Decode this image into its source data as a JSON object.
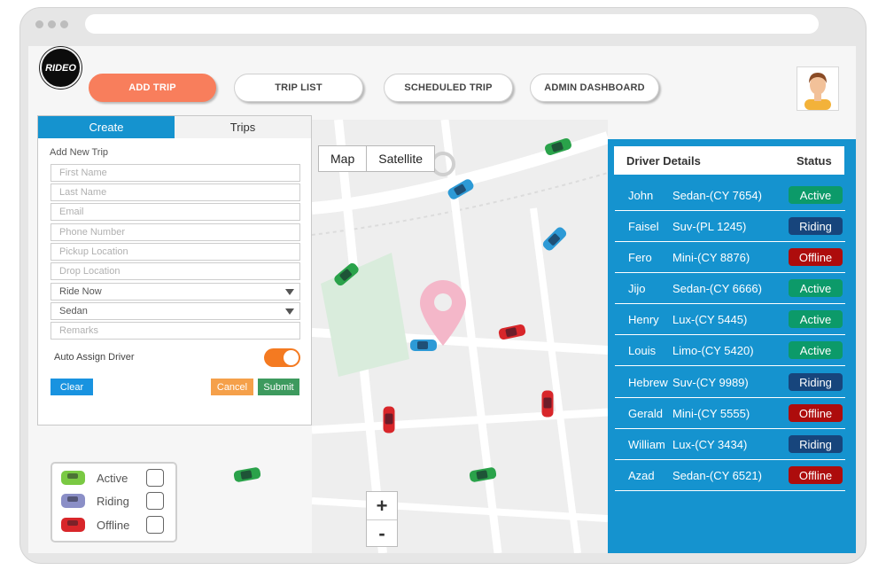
{
  "app": {
    "logo_text": "RIDEO"
  },
  "nav": {
    "add_trip": "ADD TRIP",
    "trip_list": "TRIP LIST",
    "scheduled_trip": "SCHEDULED TRIP",
    "admin_dashboard": "ADMIN DASHBOARD"
  },
  "form": {
    "tabs": {
      "create": "Create",
      "trips": "Trips"
    },
    "title": "Add New Trip",
    "fields": {
      "first_name": "First Name",
      "last_name": "Last Name",
      "email": "Email",
      "phone": "Phone Number",
      "pickup": "Pickup Location",
      "drop": "Drop Location",
      "ride_type": "Ride Now",
      "vehicle": "Sedan",
      "remarks": "Remarks"
    },
    "auto_assign_label": "Auto Assign Driver",
    "auto_assign_on": true,
    "clear": "Clear",
    "cancel": "Cancel",
    "submit": "Submit"
  },
  "map": {
    "type_map": "Map",
    "type_satellite": "Satellite",
    "zoom_in": "+",
    "zoom_out": "-"
  },
  "legend": {
    "active": "Active",
    "riding": "Riding",
    "offline": "Offline"
  },
  "drivers": {
    "header_details": "Driver Details",
    "header_status": "Status",
    "rows": [
      {
        "name": "John",
        "vehicle": "Sedan-(CY 7654)",
        "status": "Active"
      },
      {
        "name": "Faisel",
        "vehicle": "Suv-(PL 1245)",
        "status": "Riding"
      },
      {
        "name": "Fero",
        "vehicle": "Mini-(CY 8876)",
        "status": "Offline"
      },
      {
        "name": "Jijo",
        "vehicle": "Sedan-(CY 6666)",
        "status": "Active"
      },
      {
        "name": "Henry",
        "vehicle": "Lux-(CY 5445)",
        "status": "Active"
      },
      {
        "name": "Louis",
        "vehicle": "Limo-(CY 5420)",
        "status": "Active"
      },
      {
        "name": "Hebrew",
        "vehicle": "Suv-(CY 9989)",
        "status": "Riding"
      },
      {
        "name": "Gerald",
        "vehicle": "Mini-(CY 5555)",
        "status": "Offline"
      },
      {
        "name": "William",
        "vehicle": "Lux-(CY 3434)",
        "status": "Riding"
      },
      {
        "name": "Azad",
        "vehicle": "Sedan-(CY 6521)",
        "status": "Offline"
      }
    ]
  },
  "colors": {
    "accent": "#1593cf",
    "primary_button": "#f87e5c",
    "active": "#0c9a69",
    "riding": "#17457c",
    "offline": "#ad0c0c"
  }
}
